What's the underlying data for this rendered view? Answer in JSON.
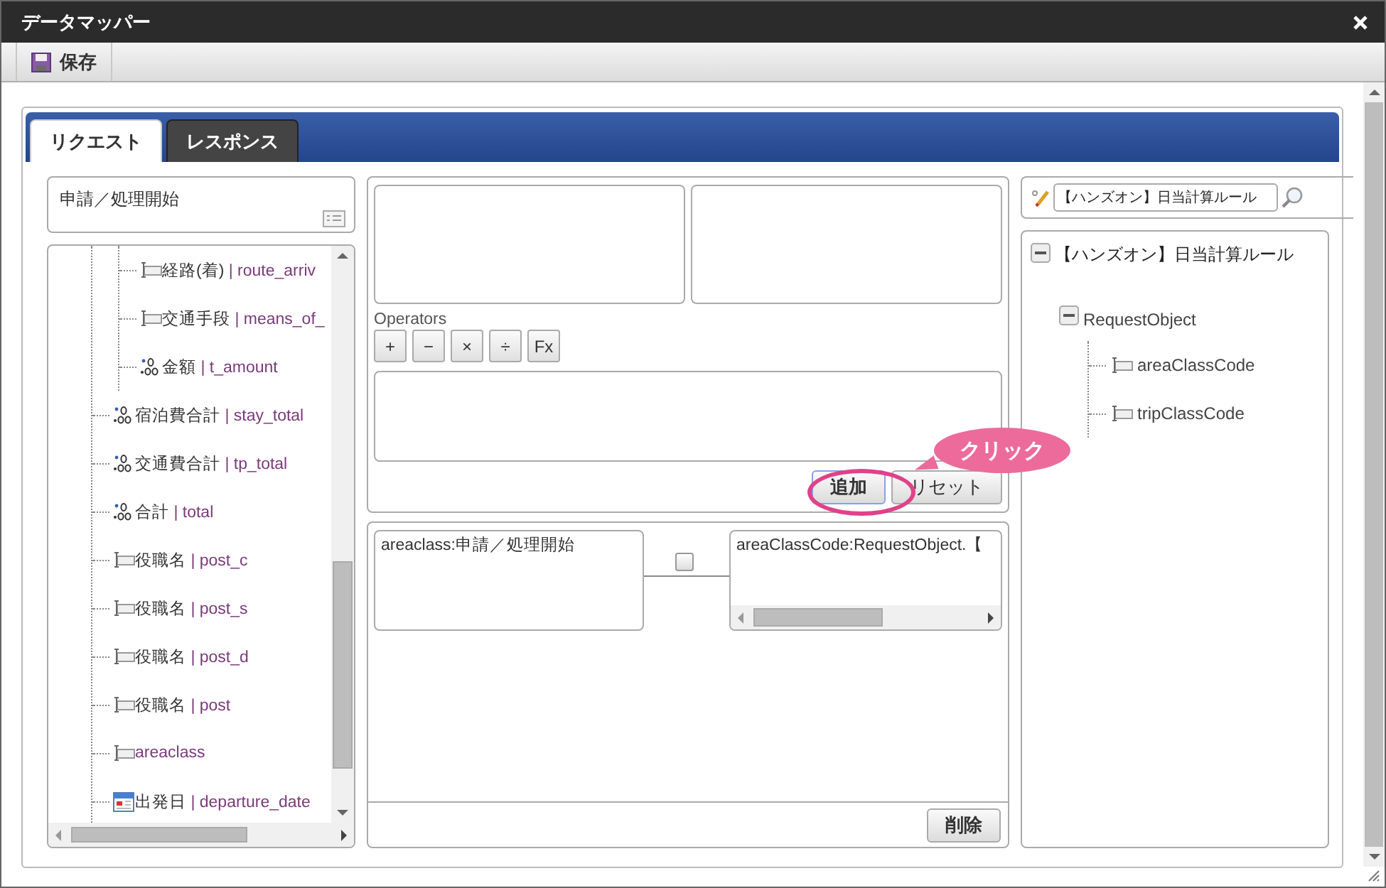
{
  "window": {
    "title": "データマッパー"
  },
  "toolbar": [
    {
      "label": "保存"
    }
  ],
  "tabs": [
    {
      "label": "リクエスト",
      "selected": true
    },
    {
      "label": "レスポンス",
      "selected": false
    }
  ],
  "source": {
    "title": "申請／処理開始",
    "tree": [
      {
        "children": [
          {
            "kind": "text",
            "label": "経路(着)",
            "field": "| route_arriv"
          },
          {
            "kind": "text",
            "label": "交通手段",
            "field": "| means_of_"
          },
          {
            "kind": "number",
            "label": "金額",
            "field": "| t_amount"
          }
        ]
      },
      {
        "kind": "number",
        "label": "宿泊費合計",
        "field": "| stay_total"
      },
      {
        "kind": "number",
        "label": "交通費合計",
        "field": "| tp_total"
      },
      {
        "kind": "number",
        "label": "合計",
        "field": "| total"
      },
      {
        "kind": "text",
        "label": "役職名",
        "field": "| post_c"
      },
      {
        "kind": "text",
        "label": "役職名",
        "field": "| post_s"
      },
      {
        "kind": "text",
        "label": "役職名",
        "field": "| post_d"
      },
      {
        "kind": "text",
        "label": "役職名",
        "field": "| post"
      },
      {
        "kind": "text",
        "field": "areaclass"
      },
      {
        "kind": "date",
        "label": "出発日",
        "field": "| departure_date"
      }
    ]
  },
  "expression": {
    "operators_label": "Operators",
    "operators": [
      "+",
      "−",
      "×",
      "÷",
      "Fx"
    ],
    "buttons": [
      {
        "label": "追加"
      },
      {
        "label": "リセット"
      }
    ]
  },
  "mappings": [
    {
      "source": "areaclass:申請／処理開始",
      "checked": false,
      "target": "areaClassCode:RequestObject.【"
    }
  ],
  "delete_button": {
    "label": "削除"
  },
  "target": {
    "search": {
      "value": "【ハンズオン】日当計算ルール"
    },
    "tree": [
      {
        "kind": "root",
        "label": "【ハンズオン】日当計算ルール",
        "expanded": true,
        "children": [
          {
            "kind": "object",
            "label": "RequestObject",
            "expanded": true,
            "children": [
              {
                "kind": "text",
                "label": "areaClassCode"
              },
              {
                "kind": "text",
                "label": "tripClassCode"
              }
            ]
          }
        ]
      }
    ]
  },
  "callout": {
    "text": "クリック"
  }
}
